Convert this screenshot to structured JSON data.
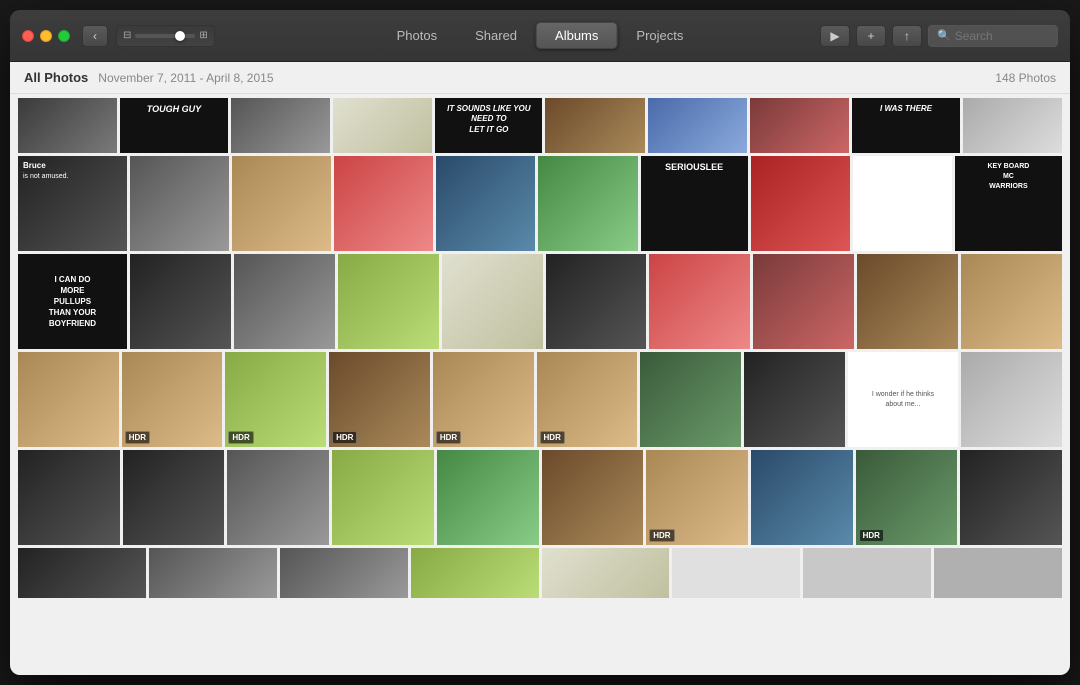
{
  "window": {
    "title": "Photos"
  },
  "titlebar": {
    "back_btn": "‹",
    "play_btn": "▶",
    "add_btn": "+",
    "share_btn": "↑",
    "search_placeholder": "Search"
  },
  "tabs": [
    {
      "id": "photos",
      "label": "Photos",
      "active": false
    },
    {
      "id": "shared",
      "label": "Shared",
      "active": false
    },
    {
      "id": "albums",
      "label": "Albums",
      "active": true
    },
    {
      "id": "projects",
      "label": "Projects",
      "active": false
    }
  ],
  "breadcrumb": {
    "section": "All Photos",
    "date_range": "November 7, 2011 - April 8, 2015",
    "count": "148 Photos"
  },
  "grid": {
    "rows": [
      [
        {
          "color": "c2",
          "text": "",
          "badge": ""
        },
        {
          "color": "c11",
          "text": "TOUGH GUY",
          "is_meme": true,
          "badge": ""
        },
        {
          "color": "c3",
          "text": "",
          "badge": ""
        },
        {
          "color": "c4",
          "text": "",
          "badge": ""
        },
        {
          "color": "c5",
          "text": "IT SOUNDS LIKE YOU NEED TO\nLET IT GO",
          "is_meme": true,
          "badge": ""
        },
        {
          "color": "c6",
          "text": "",
          "badge": ""
        },
        {
          "color": "c7",
          "text": "",
          "badge": ""
        },
        {
          "color": "c8",
          "text": "",
          "badge": ""
        },
        {
          "color": "c9",
          "text": "I WAS THERE",
          "is_meme": true,
          "badge": ""
        },
        {
          "color": "c10",
          "text": "",
          "badge": ""
        }
      ],
      [
        {
          "color": "c11",
          "text": "Bruce\nis not amused.",
          "is_meme": true,
          "badge": ""
        },
        {
          "color": "c3",
          "text": "",
          "badge": ""
        },
        {
          "color": "c12",
          "text": "",
          "badge": ""
        },
        {
          "color": "c13",
          "text": "",
          "badge": ""
        },
        {
          "color": "c5",
          "text": "",
          "badge": ""
        },
        {
          "color": "c21",
          "text": "",
          "badge": ""
        },
        {
          "color": "c11",
          "text": "SERIOUSLEE",
          "is_meme": true,
          "badge": ""
        },
        {
          "color": "c20",
          "text": "",
          "badge": ""
        },
        {
          "color": "c17",
          "text": "",
          "badge": ""
        },
        {
          "color": "c11",
          "text": "KEY BOARD\nWARRIORS",
          "is_meme": true,
          "badge": ""
        }
      ],
      [
        {
          "color": "c17",
          "text": "I CAN DO\nMORE\nPULLUPS\nTHAN YOUR\nBOYFRIEND",
          "is_text": true,
          "badge": ""
        },
        {
          "color": "c11",
          "text": "",
          "badge": ""
        },
        {
          "color": "c3",
          "text": "",
          "badge": ""
        },
        {
          "color": "c15",
          "text": "",
          "badge": ""
        },
        {
          "color": "c4",
          "text": "",
          "badge": ""
        },
        {
          "color": "c11",
          "text": "",
          "badge": ""
        },
        {
          "color": "c13",
          "text": "",
          "badge": ""
        },
        {
          "color": "c8",
          "text": "",
          "badge": ""
        },
        {
          "color": "c6",
          "text": "",
          "badge": ""
        },
        {
          "color": "c12",
          "text": "",
          "badge": ""
        }
      ],
      [
        {
          "color": "c12",
          "text": "",
          "badge": ""
        },
        {
          "color": "c12",
          "text": "",
          "badge": "HDR"
        },
        {
          "color": "c15",
          "text": "",
          "badge": "HDR"
        },
        {
          "color": "c6",
          "text": "",
          "badge": "HDR"
        },
        {
          "color": "c12",
          "text": "",
          "badge": "HDR"
        },
        {
          "color": "c12",
          "text": "",
          "badge": "HDR"
        },
        {
          "color": "c9",
          "text": "",
          "badge": ""
        },
        {
          "color": "c11",
          "text": "",
          "badge": ""
        },
        {
          "color": "c17",
          "text": "I wonder if he thinks\nabout me...",
          "is_small": true,
          "badge": ""
        },
        {
          "color": "c10",
          "text": "",
          "badge": ""
        }
      ],
      [
        {
          "color": "c11",
          "text": "",
          "badge": ""
        },
        {
          "color": "c11",
          "text": "",
          "badge": ""
        },
        {
          "color": "c3",
          "text": "",
          "badge": ""
        },
        {
          "color": "c15",
          "text": "",
          "badge": ""
        },
        {
          "color": "c21",
          "text": "",
          "badge": ""
        },
        {
          "color": "c6",
          "text": "",
          "badge": ""
        },
        {
          "color": "c12",
          "text": "",
          "badge": "HDR"
        },
        {
          "color": "c5",
          "text": "",
          "badge": ""
        },
        {
          "color": "c9",
          "text": "",
          "badge": "HDR"
        },
        {
          "color": "c11",
          "text": "",
          "badge": ""
        }
      ]
    ]
  }
}
